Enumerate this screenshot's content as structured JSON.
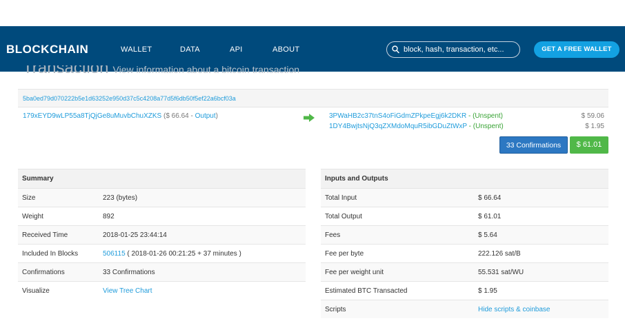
{
  "nav": {
    "logo": "BLOCKCHAIN",
    "links": [
      "WALLET",
      "DATA",
      "API",
      "ABOUT"
    ],
    "search_placeholder": "block, hash, transaction, etc...",
    "cta": "GET A FREE WALLET"
  },
  "heading": {
    "title": "Transaction",
    "subtitle": "View information about a bitcoin transaction"
  },
  "tx": {
    "hash": "5ba0ed79d070222b5e1d63252e950d37c5c4208a77d5f6db50f5ef22a6bcf03a",
    "input": {
      "address": "179xEYD9wLP55a8TjQjGe8uMuvbChuXZKS",
      "amount": "$ 66.64",
      "sep": "-",
      "output_link": "Output",
      "open_paren": "(",
      "close_paren": ")"
    },
    "outputs": [
      {
        "address": "3PWaHB2c37tnS4oFiGdmZPkpeEgj6k2DKR",
        "dash": "-",
        "status": "(Unspent)",
        "amount": "$ 59.06"
      },
      {
        "address": "1DY4BwjtsNjQ3qZXMdoMquR5ibGDuZtWxP",
        "dash": "-",
        "status": "(Unspent)",
        "amount": "$ 1.95"
      }
    ],
    "confirmations_button": "33 Confirmations",
    "total_button": "$ 61.01",
    "colors": {
      "arrow": "#50b848",
      "confirm_btn": "#2d78c2",
      "total_btn": "#50b848"
    }
  },
  "summary": {
    "title": "Summary",
    "rows": [
      {
        "label": "Size",
        "value": "223 (bytes)"
      },
      {
        "label": "Weight",
        "value": "892"
      },
      {
        "label": "Received Time",
        "value": "2018-01-25 23:44:14"
      },
      {
        "label": "Included In Blocks",
        "link": "506115",
        "value": " ( 2018-01-26 00:21:25 + 37 minutes )"
      },
      {
        "label": "Confirmations",
        "value": "33 Confirmations"
      },
      {
        "label": "Visualize",
        "link": "View Tree Chart"
      }
    ]
  },
  "io": {
    "title": "Inputs and Outputs",
    "rows": [
      {
        "label": "Total Input",
        "value": "$ 66.64"
      },
      {
        "label": "Total Output",
        "value": "$ 61.01"
      },
      {
        "label": "Fees",
        "value": "$ 5.64"
      },
      {
        "label": "Fee per byte",
        "value": "222.126 sat/B"
      },
      {
        "label": "Fee per weight unit",
        "value": "55.531 sat/WU"
      },
      {
        "label": "Estimated BTC Transacted",
        "value": "$ 1.95"
      },
      {
        "label": "Scripts",
        "link": "Hide scripts & coinbase"
      }
    ]
  }
}
